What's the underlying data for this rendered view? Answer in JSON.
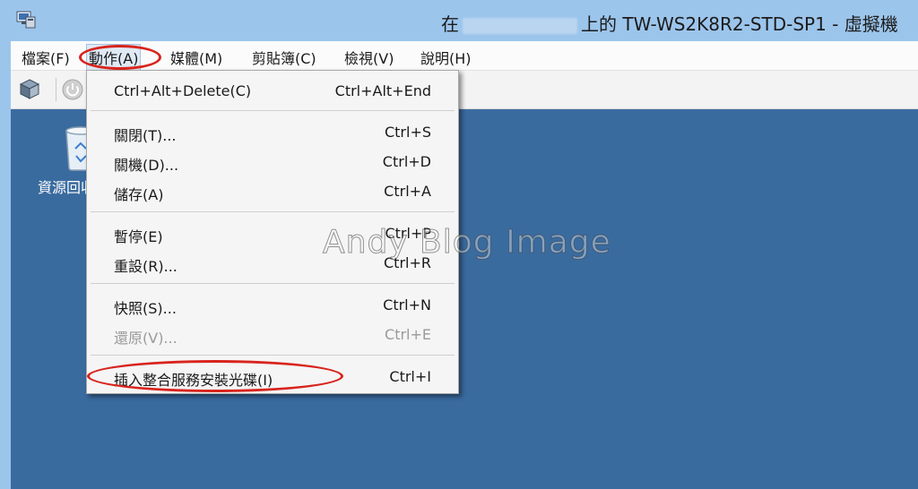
{
  "window": {
    "title_prefix": "在",
    "title_suffix": "上的 TW-WS2K8R2-STD-SP1 - 虛擬機"
  },
  "menubar": {
    "items": [
      {
        "label": "檔案(F)"
      },
      {
        "label": "動作(A)"
      },
      {
        "label": "媒體(M)"
      },
      {
        "label": "剪貼簿(C)"
      },
      {
        "label": "檢視(V)"
      },
      {
        "label": "說明(H)"
      }
    ]
  },
  "desktop": {
    "recycle_bin_label": "資源回收筒"
  },
  "action_menu": {
    "items": [
      {
        "label": "Ctrl+Alt+Delete(C)",
        "shortcut": "Ctrl+Alt+End"
      },
      {
        "label": "關閉(T)...",
        "shortcut": "Ctrl+S"
      },
      {
        "label": "關機(D)...",
        "shortcut": "Ctrl+D"
      },
      {
        "label": "儲存(A)",
        "shortcut": "Ctrl+A"
      },
      {
        "label": "暫停(E)",
        "shortcut": "Ctrl+P"
      },
      {
        "label": "重設(R)...",
        "shortcut": "Ctrl+R"
      },
      {
        "label": "快照(S)...",
        "shortcut": "Ctrl+N"
      },
      {
        "label": "還原(V)...",
        "shortcut": "Ctrl+E",
        "disabled": true
      },
      {
        "label": "插入整合服務安裝光碟(I)",
        "shortcut": "Ctrl+I"
      }
    ]
  },
  "watermark": "Andy Blog Image",
  "colors": {
    "titlebar": "#9cc5ec",
    "desktop": "#3a6b9f",
    "highlight_oval": "#d8241d"
  }
}
